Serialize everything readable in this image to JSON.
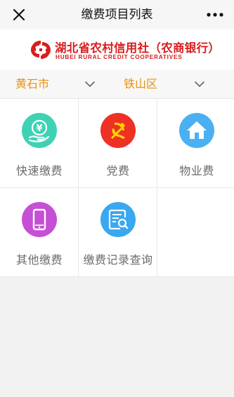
{
  "navbar": {
    "title": "缴费项目列表",
    "close_icon": "close-icon",
    "more_icon": "more-icon"
  },
  "banner": {
    "bank_name_cn": "湖北省农村信用社（农商银行）",
    "bank_name_en": "HUBEI RURAL CREDIT COOPERATIVES",
    "logo_icon": "bank-logo-icon",
    "brand_color": "#d81e1e"
  },
  "region": {
    "city": "黄石市",
    "district": "铁山区",
    "accent_color": "#e8900f"
  },
  "items": [
    {
      "label": "快速缴费",
      "icon": "quick-pay-icon",
      "color": "#3ed2b4"
    },
    {
      "label": "党费",
      "icon": "party-fee-icon",
      "color": "#ee3124"
    },
    {
      "label": "物业费",
      "icon": "house-icon",
      "color": "#4ab0f2"
    },
    {
      "label": "其他缴费",
      "icon": "phone-icon",
      "color": "#c64fd6"
    },
    {
      "label": "缴费记录查询",
      "icon": "record-search-icon",
      "color": "#3aa8f0"
    }
  ]
}
